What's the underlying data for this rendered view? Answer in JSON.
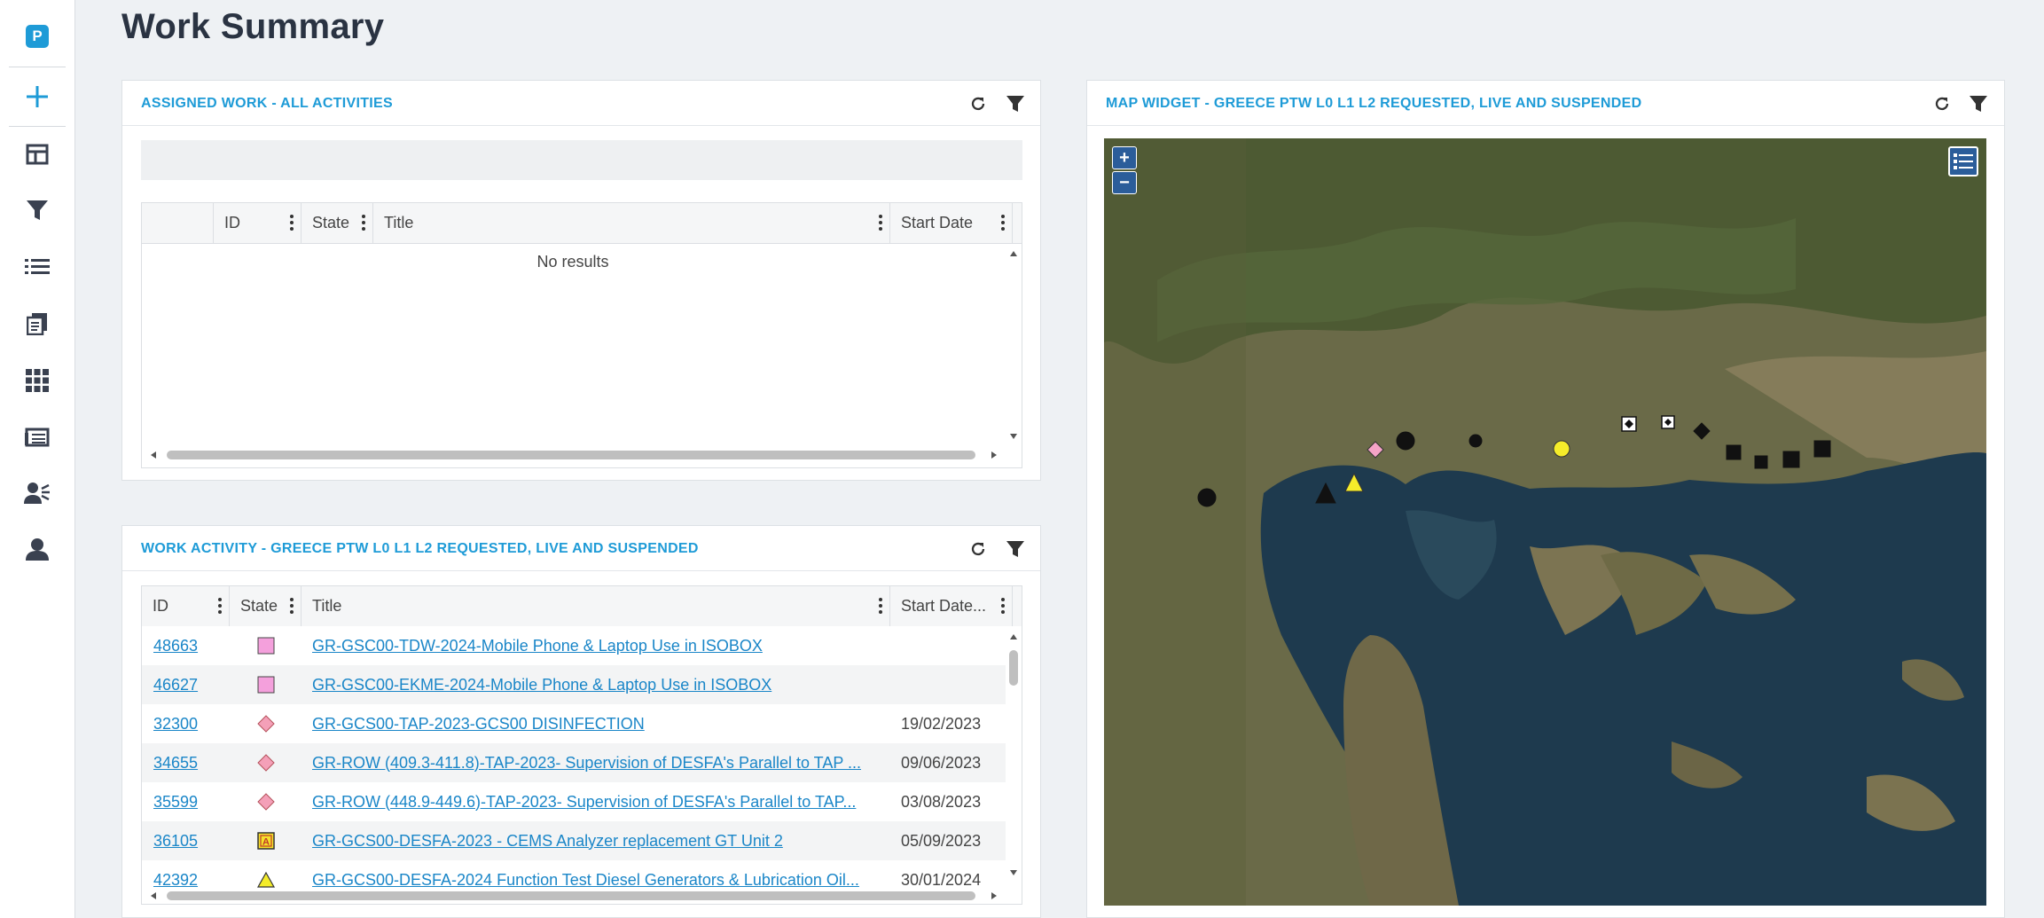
{
  "page": {
    "title": "Work Summary"
  },
  "sidebar": {
    "logo_letter": "P",
    "items": [
      {
        "icon": "plus-icon"
      },
      {
        "icon": "dashboard-icon"
      },
      {
        "icon": "filter-icon"
      },
      {
        "icon": "list-icon"
      },
      {
        "icon": "documents-icon"
      },
      {
        "icon": "grid-icon"
      },
      {
        "icon": "table-icon"
      },
      {
        "icon": "users-icon"
      },
      {
        "icon": "user-icon"
      }
    ]
  },
  "assigned": {
    "title": "ASSIGNED WORK - ALL ACTIVITIES",
    "columns": [
      "ID",
      "State",
      "Title",
      "Start Date"
    ],
    "empty_text": "No results"
  },
  "activity": {
    "title": "WORK ACTIVITY - GREECE PTW L0 L1 L2 REQUESTED, LIVE AND SUSPENDED",
    "columns": [
      "ID",
      "State",
      "Title",
      "Start Date..."
    ],
    "rows": [
      {
        "id": "48663",
        "state": "pink-square",
        "title": "GR-GSC00-TDW-2024-Mobile Phone & Laptop Use in ISOBOX",
        "start": ""
      },
      {
        "id": "46627",
        "state": "pink-square",
        "title": "GR-GSC00-EKME-2024-Mobile Phone & Laptop Use in ISOBOX",
        "start": ""
      },
      {
        "id": "32300",
        "state": "pink-diamond",
        "title": "GR-GCS00-TAP-2023-GCS00 DISINFECTION",
        "start": "19/02/2023"
      },
      {
        "id": "34655",
        "state": "pink-diamond",
        "title": "GR-ROW (409.3-411.8)-TAP-2023- Supervision of DESFA's Parallel to TAP ...",
        "start": "09/06/2023"
      },
      {
        "id": "35599",
        "state": "pink-diamond",
        "title": "GR-ROW (448.9-449.6)-TAP-2023- Supervision of DESFA's Parallel to TAP...",
        "start": "03/08/2023"
      },
      {
        "id": "36105",
        "state": "yellow-a-square",
        "title": "GR-GCS00-DESFA-2023 - CEMS Analyzer replacement GT Unit 2",
        "start": "05/09/2023"
      },
      {
        "id": "42392",
        "state": "yellow-triangle",
        "title": "GR-GCS00-DESFA-2024 Function Test Diesel Generators & Lubrication Oil...",
        "start": "30/01/2024"
      }
    ]
  },
  "map": {
    "title": "MAP WIDGET - GREECE PTW L0 L1 L2 REQUESTED, LIVE AND SUSPENDED",
    "zoom_in": "+",
    "zoom_out": "−",
    "markers": [
      {
        "shape": "circle",
        "color": "#111111"
      },
      {
        "shape": "triangle",
        "color": "#111111"
      },
      {
        "shape": "triangle",
        "color": "#f5ec2a"
      },
      {
        "shape": "diamond",
        "color": "#f5a3c7"
      },
      {
        "shape": "circle",
        "color": "#111111"
      },
      {
        "shape": "circle",
        "color": "#111111"
      },
      {
        "shape": "circle",
        "color": "#f5ec2a"
      },
      {
        "shape": "boxed-diamond",
        "color": "#111111"
      },
      {
        "shape": "boxed-diamond",
        "color": "#111111"
      },
      {
        "shape": "diamond",
        "color": "#111111"
      },
      {
        "shape": "square",
        "color": "#111111"
      },
      {
        "shape": "square",
        "color": "#111111"
      },
      {
        "shape": "square",
        "color": "#111111"
      },
      {
        "shape": "square",
        "color": "#111111"
      }
    ]
  },
  "colors": {
    "accent": "#1e9bd7",
    "link": "#1a86c8"
  }
}
